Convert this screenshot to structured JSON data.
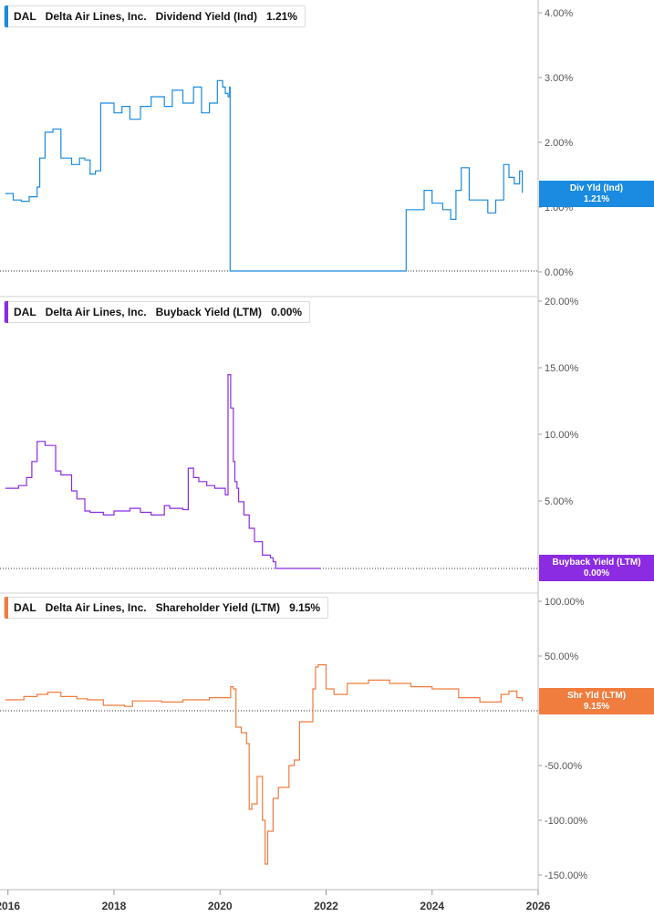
{
  "chart_data": [
    {
      "type": "line",
      "ticker": "DAL",
      "company": "Delta Air Lines, Inc.",
      "metric": "Dividend Yield (Ind)",
      "current": "1.21%",
      "tag_label": "Div Yld (Ind)",
      "tag_value": "1.21%",
      "color": "#1a8be0",
      "ylim": [
        0,
        4
      ],
      "yticks": [
        "4.00%",
        "3.00%",
        "2.00%",
        "1.00%",
        "0.00%"
      ],
      "series": [
        {
          "x": [
            2015.95,
            2016.1,
            2016.25,
            2016.4,
            2016.55,
            2016.6,
            2016.7,
            2016.85,
            2017.0,
            2017.2,
            2017.35,
            2017.45,
            2017.55,
            2017.65,
            2017.75,
            2018.0,
            2018.15,
            2018.3,
            2018.5,
            2018.7,
            2018.95,
            2019.1,
            2019.3,
            2019.5,
            2019.65,
            2019.8,
            2019.95,
            2020.05,
            2020.1,
            2020.15,
            2020.18,
            2020.19,
            2023.5,
            2023.51,
            2023.7,
            2023.85,
            2024.0,
            2024.2,
            2024.35,
            2024.45,
            2024.55,
            2024.7,
            2024.85,
            2025.05,
            2025.2,
            2025.35,
            2025.45,
            2025.55,
            2025.65,
            2025.7
          ],
          "y": [
            1.2,
            1.1,
            1.08,
            1.15,
            1.3,
            1.75,
            2.15,
            2.2,
            1.75,
            1.65,
            1.75,
            1.72,
            1.5,
            1.55,
            2.6,
            2.45,
            2.55,
            2.35,
            2.55,
            2.7,
            2.55,
            2.8,
            2.6,
            2.85,
            2.45,
            2.6,
            2.95,
            2.85,
            2.75,
            2.7,
            2.85,
            0,
            0,
            0.95,
            0.95,
            1.25,
            1.05,
            0.95,
            0.8,
            1.25,
            1.6,
            1.1,
            1.1,
            0.9,
            1.1,
            1.65,
            1.45,
            1.35,
            1.55,
            1.21
          ]
        }
      ]
    },
    {
      "type": "line",
      "ticker": "DAL",
      "company": "Delta Air Lines, Inc.",
      "metric": "Buyback Yield (LTM)",
      "current": "0.00%",
      "tag_label": "Buyback Yield (LTM)",
      "tag_value": "0.00%",
      "color": "#8b2be2",
      "ylim": [
        0,
        20
      ],
      "yticks": [
        "20.00%",
        "15.00%",
        "10.00%",
        "5.00%"
      ],
      "series": [
        {
          "x": [
            2015.95,
            2016.2,
            2016.35,
            2016.45,
            2016.55,
            2016.7,
            2016.9,
            2017.0,
            2017.2,
            2017.3,
            2017.45,
            2017.55,
            2017.8,
            2018.0,
            2018.3,
            2018.5,
            2018.7,
            2018.95,
            2019.05,
            2019.3,
            2019.4,
            2019.5,
            2019.6,
            2019.75,
            2019.9,
            2020.1,
            2020.15,
            2020.2,
            2020.25,
            2020.28,
            2020.32,
            2020.35,
            2020.45,
            2020.55,
            2020.65,
            2020.8,
            2020.95,
            2021.0,
            2021.05,
            2021.9
          ],
          "y": [
            6.0,
            6.2,
            6.8,
            8.0,
            9.5,
            9.2,
            7.3,
            7.0,
            5.8,
            5.2,
            4.3,
            4.2,
            4.0,
            4.3,
            4.5,
            4.2,
            4.0,
            4.7,
            4.5,
            4.4,
            7.5,
            6.8,
            6.5,
            6.2,
            6.0,
            5.5,
            14.5,
            12.0,
            8.0,
            6.5,
            6.0,
            5.0,
            4.0,
            3.0,
            2.0,
            1.0,
            0.8,
            0.5,
            0.0,
            0.0
          ]
        }
      ]
    },
    {
      "type": "line",
      "ticker": "DAL",
      "company": "Delta Air Lines, Inc.",
      "metric": "Shareholder Yield (LTM)",
      "current": "9.15%",
      "tag_label": "Shr Yld (LTM)",
      "tag_value": "9.15%",
      "color": "#f07c3e",
      "ylim": [
        -160,
        100
      ],
      "yticks": [
        "100.00%",
        "50.00%",
        "0.00%",
        "-50.00%",
        "-100.00%",
        "-150.00%"
      ],
      "series": [
        {
          "x": [
            2015.95,
            2016.3,
            2016.55,
            2016.75,
            2017.0,
            2017.3,
            2017.5,
            2017.8,
            2018.2,
            2018.35,
            2018.6,
            2018.9,
            2019.3,
            2019.5,
            2019.8,
            2020.0,
            2020.2,
            2020.25,
            2020.3,
            2020.4,
            2020.5,
            2020.55,
            2020.6,
            2020.7,
            2020.8,
            2020.85,
            2020.9,
            2021.0,
            2021.1,
            2021.3,
            2021.4,
            2021.5,
            2021.7,
            2021.75,
            2021.8,
            2021.85,
            2022.0,
            2022.15,
            2022.4,
            2022.8,
            2023.2,
            2023.6,
            2024.0,
            2024.5,
            2024.9,
            2025.3,
            2025.45,
            2025.6,
            2025.7
          ],
          "y": [
            10,
            13,
            15,
            17,
            13,
            11,
            10,
            5,
            4,
            9,
            9,
            8,
            10,
            10,
            12,
            12,
            22,
            20,
            -15,
            -20,
            -30,
            -90,
            -85,
            -60,
            -100,
            -140,
            -110,
            -80,
            -70,
            -50,
            -45,
            -10,
            -10,
            20,
            40,
            42,
            20,
            15,
            25,
            28,
            25,
            22,
            20,
            12,
            8,
            15,
            18,
            12,
            9.15
          ]
        }
      ]
    }
  ],
  "x_axis": {
    "xlim": [
      2015.85,
      2026.0
    ],
    "ticks": [
      2016,
      2018,
      2020,
      2022,
      2024,
      2026
    ],
    "tick_labels": [
      "2016",
      "2018",
      "2020",
      "2022",
      "2024",
      "2026"
    ]
  }
}
